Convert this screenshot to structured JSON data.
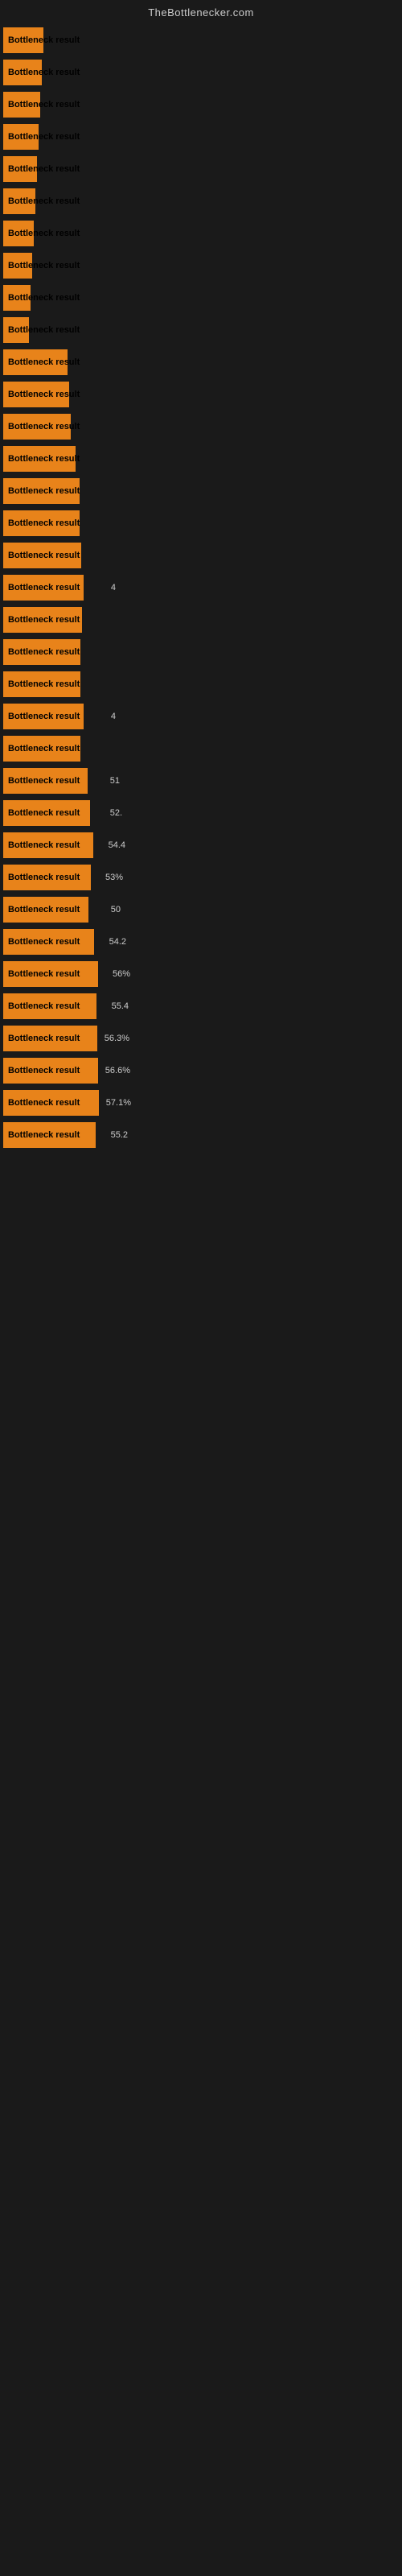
{
  "header": {
    "title": "TheBottlenecker.com"
  },
  "bars": [
    {
      "label": "Bottleneck result",
      "width": 50,
      "value": ""
    },
    {
      "label": "Bottleneck result",
      "width": 48,
      "value": ""
    },
    {
      "label": "Bottleneck result",
      "width": 46,
      "value": ""
    },
    {
      "label": "Bottleneck result",
      "width": 44,
      "value": ""
    },
    {
      "label": "Bottleneck result",
      "width": 42,
      "value": ""
    },
    {
      "label": "Bottleneck result",
      "width": 40,
      "value": ""
    },
    {
      "label": "Bottleneck result",
      "width": 38,
      "value": ""
    },
    {
      "label": "Bottleneck result",
      "width": 36,
      "value": ""
    },
    {
      "label": "Bottleneck result",
      "width": 34,
      "value": ""
    },
    {
      "label": "Bottleneck result",
      "width": 32,
      "value": ""
    },
    {
      "label": "Bottleneck result",
      "width": 80,
      "value": ""
    },
    {
      "label": "Bottleneck result",
      "width": 82,
      "value": ""
    },
    {
      "label": "Bottleneck result",
      "width": 84,
      "value": ""
    },
    {
      "label": "Bottleneck result",
      "width": 90,
      "value": ""
    },
    {
      "label": "Bottleneck result",
      "width": 95,
      "value": ""
    },
    {
      "label": "Bottleneck result",
      "width": 95,
      "value": ""
    },
    {
      "label": "Bottleneck result",
      "width": 97,
      "value": ""
    },
    {
      "label": "Bottleneck result",
      "width": 100,
      "value": "4"
    },
    {
      "label": "Bottleneck result",
      "width": 98,
      "value": ""
    },
    {
      "label": "Bottleneck result",
      "width": 96,
      "value": ""
    },
    {
      "label": "Bottleneck result",
      "width": 96,
      "value": ""
    },
    {
      "label": "Bottleneck result",
      "width": 100,
      "value": "4"
    },
    {
      "label": "Bottleneck result",
      "width": 96,
      "value": ""
    },
    {
      "label": "Bottleneck result",
      "width": 105,
      "value": "51"
    },
    {
      "label": "Bottleneck result",
      "width": 108,
      "value": "52."
    },
    {
      "label": "Bottleneck result",
      "width": 112,
      "value": "54.4"
    },
    {
      "label": "Bottleneck result",
      "width": 109,
      "value": "53%"
    },
    {
      "label": "Bottleneck result",
      "width": 106,
      "value": "50"
    },
    {
      "label": "Bottleneck result",
      "width": 113,
      "value": "54.2"
    },
    {
      "label": "Bottleneck result",
      "width": 118,
      "value": "56%"
    },
    {
      "label": "Bottleneck result",
      "width": 116,
      "value": "55.4"
    },
    {
      "label": "Bottleneck result",
      "width": 117,
      "value": "56.3%"
    },
    {
      "label": "Bottleneck result",
      "width": 118,
      "value": "56.6%"
    },
    {
      "label": "Bottleneck result",
      "width": 119,
      "value": "57.1%"
    },
    {
      "label": "Bottleneck result",
      "width": 115,
      "value": "55.2"
    }
  ]
}
